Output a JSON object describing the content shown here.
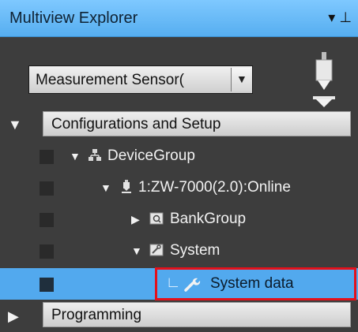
{
  "window": {
    "title": "Multiview Explorer",
    "dropdown_glyph": "▼",
    "pin_glyph": "📌"
  },
  "device_select": {
    "value": "Measurement Sensor(",
    "arrow": "▼"
  },
  "sections": {
    "config": {
      "label": "Configurations and Setup",
      "expanded_glyph": "▼"
    },
    "programming": {
      "label": "Programming",
      "collapsed_glyph": "▶"
    }
  },
  "tree": {
    "device_group": {
      "label": "DeviceGroup",
      "glyph": "▼"
    },
    "sensor": {
      "label": "1:ZW-7000(2.0):Online",
      "glyph": "▼"
    },
    "bank_group": {
      "label": "BankGroup",
      "glyph": "▶"
    },
    "system": {
      "label": "System",
      "glyph": "▼"
    },
    "system_data": {
      "label": "System data",
      "branch_glyph": "∟"
    }
  },
  "colors": {
    "accent": "#52a9ee",
    "highlight": "#e4111b",
    "background": "#3d3d3d"
  }
}
